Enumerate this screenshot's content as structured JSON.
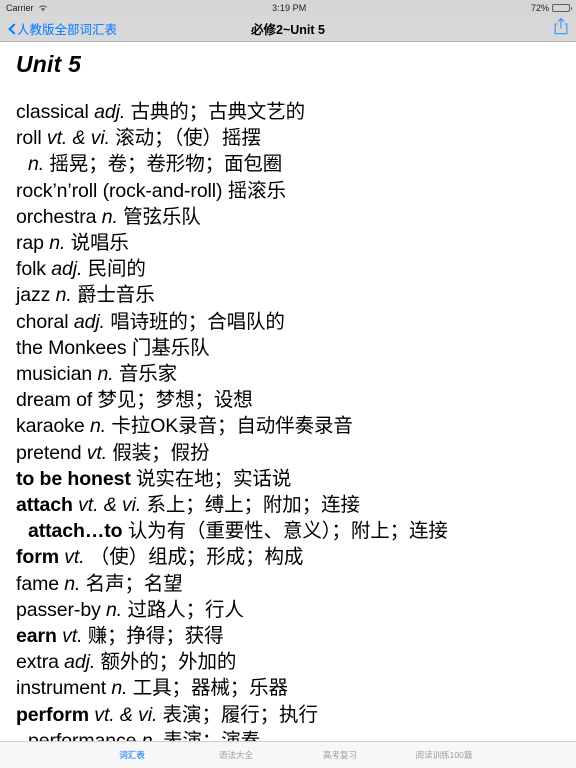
{
  "status_bar": {
    "carrier": "Carrier",
    "wifi_icon": "wifi-icon",
    "time": "3:19 PM",
    "battery_percent": "72%",
    "battery_icon": "battery-icon"
  },
  "nav_bar": {
    "back_icon": "chevron-left-icon",
    "back_label": "人教版全部词汇表",
    "title": "必修2~Unit 5",
    "share_icon": "share-icon"
  },
  "content": {
    "unit_title": "Unit 5",
    "entries": [
      {
        "head": "classical ",
        "pos": "adj.",
        "def": " 古典的；古典文艺的",
        "bold": false,
        "indent": false
      },
      {
        "head": "roll ",
        "pos": "vt. & vi.",
        "def": " 滚动；（使）摇摆",
        "bold": false,
        "indent": false
      },
      {
        "head": "",
        "pos": "n.",
        "def": " 摇晃；卷；卷形物；面包圈",
        "bold": false,
        "indent": true
      },
      {
        "head": "rock’n’roll (rock-and-roll) 摇滚乐",
        "pos": "",
        "def": "",
        "bold": false,
        "indent": false
      },
      {
        "head": "orchestra ",
        "pos": "n.",
        "def": " 管弦乐队",
        "bold": false,
        "indent": false
      },
      {
        "head": "rap ",
        "pos": "n.",
        "def": " 说唱乐",
        "bold": false,
        "indent": false
      },
      {
        "head": "folk ",
        "pos": "adj.",
        "def": " 民间的",
        "bold": false,
        "indent": false
      },
      {
        "head": "jazz ",
        "pos": "n.",
        "def": " 爵士音乐",
        "bold": false,
        "indent": false
      },
      {
        "head": "choral ",
        "pos": "adj.",
        "def": " 唱诗班的；合唱队的",
        "bold": false,
        "indent": false
      },
      {
        "head": "the Monkees 门基乐队",
        "pos": "",
        "def": "",
        "bold": false,
        "indent": false
      },
      {
        "head": "musician ",
        "pos": "n.",
        "def": " 音乐家",
        "bold": false,
        "indent": false
      },
      {
        "head": "dream of 梦见；梦想；设想",
        "pos": "",
        "def": "",
        "bold": false,
        "indent": false
      },
      {
        "head": "karaoke ",
        "pos": "n.",
        "def": " 卡拉OK录音；自动伴奏录音",
        "bold": false,
        "indent": false
      },
      {
        "head": "pretend  ",
        "pos": "vt.",
        "def": " 假装；假扮",
        "bold": false,
        "indent": false
      },
      {
        "head": "to be honest",
        "pos": "",
        "def": " 说实在地；实话说",
        "bold": true,
        "indent": false
      },
      {
        "head": "attach ",
        "pos": "vt. & vi.",
        "def": " 系上；缚上；附加；连接",
        "bold": true,
        "indent": false
      },
      {
        "head": "attach…to",
        "pos": "",
        "def": " 认为有（重要性、意义）；附上；连接",
        "bold": true,
        "indent": true
      },
      {
        "head": "form ",
        "pos": "vt.",
        "def": " （使）组成；形成；构成",
        "bold": true,
        "indent": false
      },
      {
        "head": "fame ",
        "pos": "n.",
        "def": " 名声；名望",
        "bold": false,
        "indent": false
      },
      {
        "head": "passer-by ",
        "pos": "n.",
        "def": " 过路人；行人",
        "bold": false,
        "indent": false
      },
      {
        "head": "earn ",
        "pos": "vt.",
        "def": " 赚；挣得；获得",
        "bold": true,
        "indent": false
      },
      {
        "head": "extra ",
        "pos": "adj.",
        "def": " 额外的；外加的",
        "bold": false,
        "indent": false
      },
      {
        "head": "instrument ",
        "pos": "n.",
        "def": " 工具；器械；乐器",
        "bold": false,
        "indent": false
      },
      {
        "head": "perform ",
        "pos": "vt. & vi.",
        "def": " 表演；履行；执行",
        "bold": true,
        "indent": false
      },
      {
        "head": "performance ",
        "pos": "n.",
        "def": " 表演；演奏",
        "bold": false,
        "indent": true
      }
    ]
  },
  "tab_bar": {
    "tabs": [
      {
        "label": "词汇表",
        "active": true
      },
      {
        "label": "语法大全",
        "active": false
      },
      {
        "label": "高考复习",
        "active": false
      },
      {
        "label": "阅读训练100篇",
        "active": false
      }
    ]
  }
}
